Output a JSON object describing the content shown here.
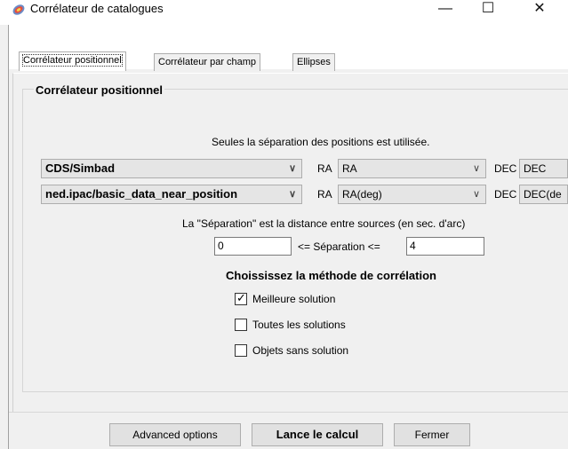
{
  "window": {
    "title": "Corrélateur de catalogues",
    "minimize": "—",
    "maximize": "☐",
    "close": "✕"
  },
  "tabs": [
    {
      "label": "Corrélateur positionnel",
      "active": true
    },
    {
      "label": "Corrélateur par champ",
      "active": false
    },
    {
      "label": "Ellipses",
      "active": false
    }
  ],
  "group": {
    "title": "Corrélateur positionnel",
    "info": "Seules la séparation des positions est utilisée.",
    "rows": [
      {
        "catalog": "CDS/Simbad",
        "ra_label": "RA",
        "ra_value": "RA",
        "dec_label": "DEC",
        "dec_value": "DEC"
      },
      {
        "catalog": "ned.ipac/basic_data_near_position",
        "ra_label": "RA",
        "ra_value": "RA(deg)",
        "dec_label": "DEC",
        "dec_value": "DEC(de"
      }
    ],
    "separation_note": "La \"Séparation\" est la distance entre sources (en sec. d'arc)",
    "sep_min": "0",
    "sep_label": "<= Séparation <=",
    "sep_max": "4",
    "method_title": "Choississez la méthode de corrélation",
    "options": [
      {
        "label": "Meilleure solution",
        "checked": true
      },
      {
        "label": "Toutes les solutions",
        "checked": false
      },
      {
        "label": "Objets sans solution",
        "checked": false
      }
    ]
  },
  "buttons": {
    "advanced": "Advanced options",
    "compute": "Lance le calcul",
    "close": "Fermer"
  },
  "colors": {
    "window_bg": "#f0f0f0",
    "combo_bg": "#e5e5e5",
    "button_bg": "#e1e1e1"
  }
}
